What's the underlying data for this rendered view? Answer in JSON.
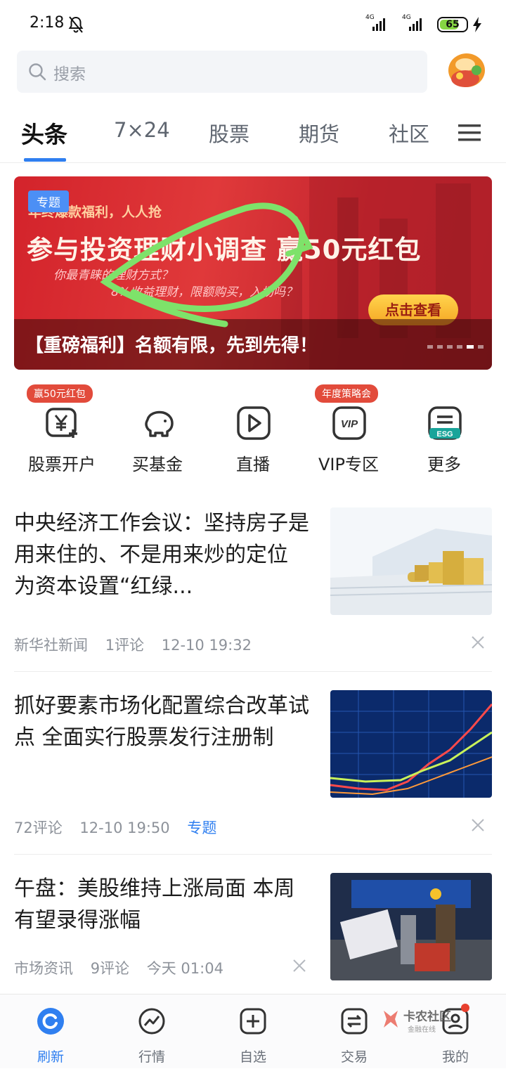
{
  "status_bar": {
    "time": "2:18",
    "net1": "4G",
    "net2": "4G",
    "battery": "65"
  },
  "search": {
    "placeholder": "搜索"
  },
  "tabs": [
    {
      "label": "头条",
      "active": true
    },
    {
      "label": "7×24"
    },
    {
      "label": "股票"
    },
    {
      "label": "期货"
    },
    {
      "label": "社区"
    }
  ],
  "banner": {
    "badge": "专题",
    "small_top": "年终爆款福利，人人抢",
    "headline": "参与投资理财小调查 赢50元红包",
    "question1": "你最青睐的理财方式？",
    "question2": "8%收益理财，限额购买，入场吗？",
    "cta": "点击查看",
    "caption": "【重磅福利】名额有限，先到先得！"
  },
  "quick_actions": [
    {
      "label": "股票开户",
      "tag": "赢50元红包"
    },
    {
      "label": "买基金"
    },
    {
      "label": "直播"
    },
    {
      "label": "VIP专区",
      "tag": "年度策略会"
    },
    {
      "label": "更多"
    }
  ],
  "news": [
    {
      "title": "中央经济工作会议：坚持房子是用来住的、不是用来炒的定位 为资本设置“红绿...",
      "meta": [
        "新华社新闻",
        "1评论",
        "12-10 19:32"
      ]
    },
    {
      "title": "抓好要素市场化配置综合改革试点 全面实行股票发行注册制",
      "meta": [
        "72评论",
        "12-10 19:50"
      ],
      "topic": "专题"
    },
    {
      "title": "午盘：美股维持上涨局面 本周有望录得涨幅",
      "meta": [
        "市场资讯",
        "9评论",
        "今天 01:04"
      ]
    }
  ],
  "bottom_nav": [
    {
      "label": "刷新",
      "active": true
    },
    {
      "label": "行情"
    },
    {
      "label": "自选"
    },
    {
      "label": "交易"
    },
    {
      "label": "我的"
    }
  ],
  "watermark": {
    "brand": "卡农社区",
    "sub": "金融在线"
  },
  "colors": {
    "accent": "#2f7ff0",
    "banner_red": "#d3232b",
    "tag_red": "#e24b3b"
  }
}
